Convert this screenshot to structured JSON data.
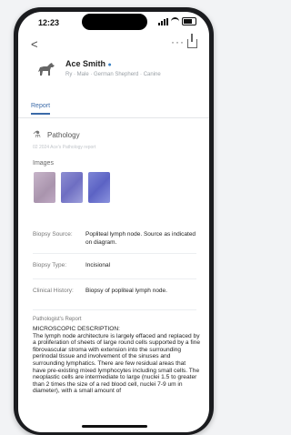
{
  "status_bar": {
    "time": "12:23"
  },
  "nav": {
    "back_label": "<",
    "more_label": "···"
  },
  "patient": {
    "name": "Ace Smith",
    "details": "Ry · Male · German Shepherd · Canine"
  },
  "tabs": [
    {
      "label": "Report"
    }
  ],
  "section": {
    "title": "Pathology",
    "subtitle": "02 2024 Ace's Pathology report"
  },
  "images": {
    "label": "Images",
    "count": 3
  },
  "fields": [
    {
      "key": "Biopsy Source:",
      "value": "Popliteal lymph node. Source as indicated on diagram."
    },
    {
      "key": "Biopsy Type:",
      "value": "Incisional"
    },
    {
      "key": "Clinical History:",
      "value": "Biopsy of popliteal lymph node."
    }
  ],
  "report": {
    "label": "Pathologist's Report",
    "heading": "MICROSCOPIC DESCRIPTION:",
    "body": "The lymph node architecture is largely effaced and replaced by a proliferation of sheets of large round cells supported by a fine fibrovascular stroma with extension into the surrounding perinodal tissue and involvement of the sinuses and surrounding lymphatics. There are few residual areas that have pre-existing mixed lymphocytes including small cells. The neoplastic cells are intermediate to large (nuclei 1.5 to greater than 2 times the size of a red blood cell, nuclei 7-9 um in diameter), with a small amount of"
  }
}
